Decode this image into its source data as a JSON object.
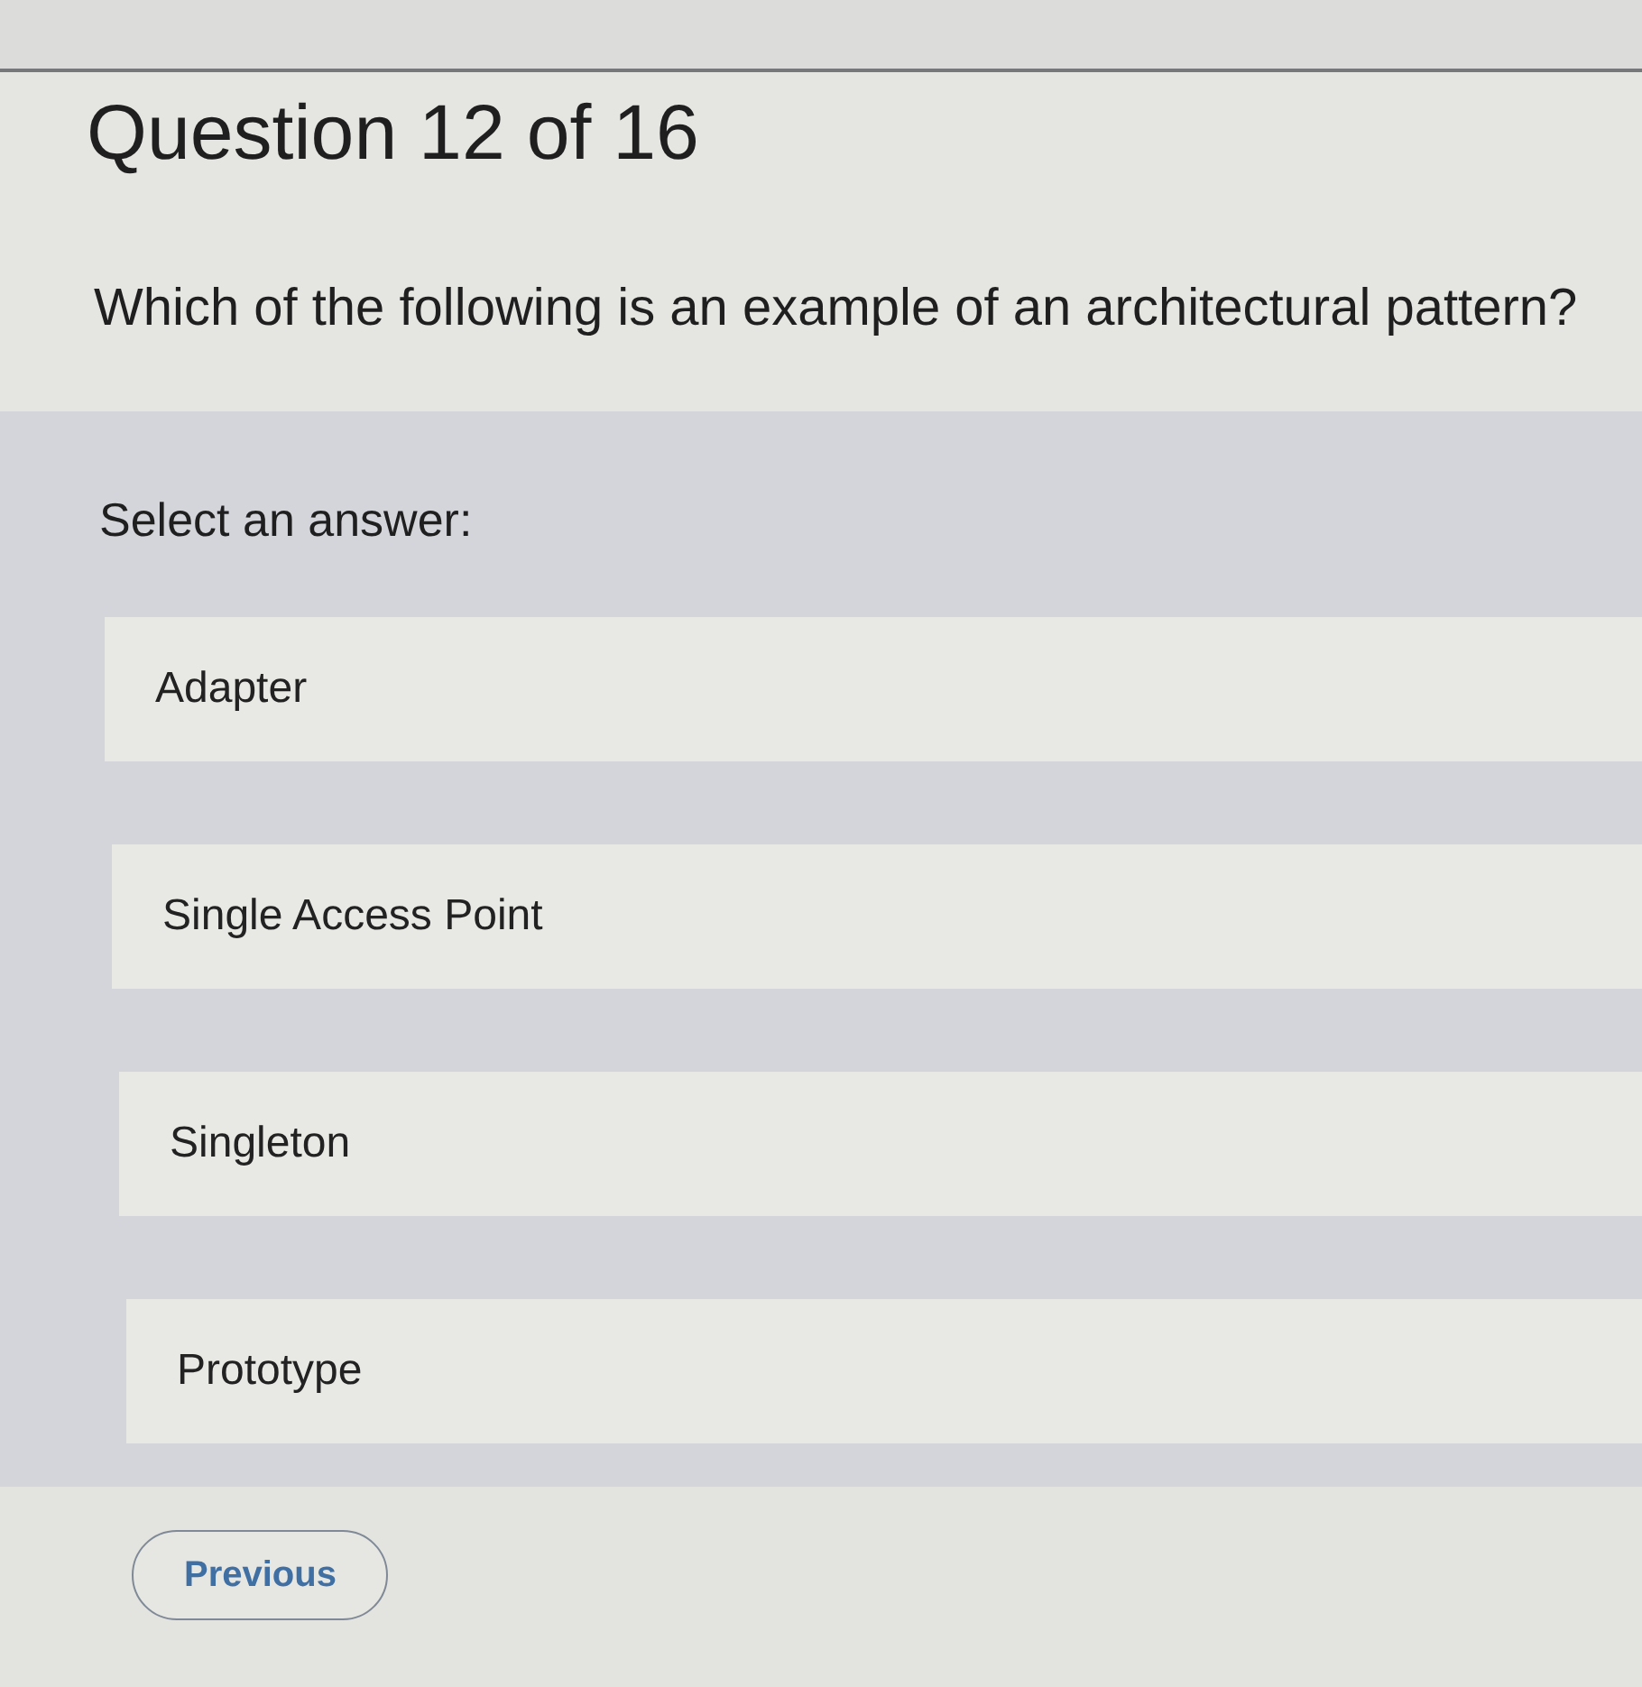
{
  "header": {
    "title": "Question 12 of 16",
    "question": "Which of the following is an example of an architectural pattern?"
  },
  "answers": {
    "prompt": "Select an answer:",
    "options": [
      {
        "label": "Adapter"
      },
      {
        "label": "Single Access Point"
      },
      {
        "label": "Singleton"
      },
      {
        "label": "Prototype"
      }
    ]
  },
  "navigation": {
    "previous": "Previous"
  }
}
